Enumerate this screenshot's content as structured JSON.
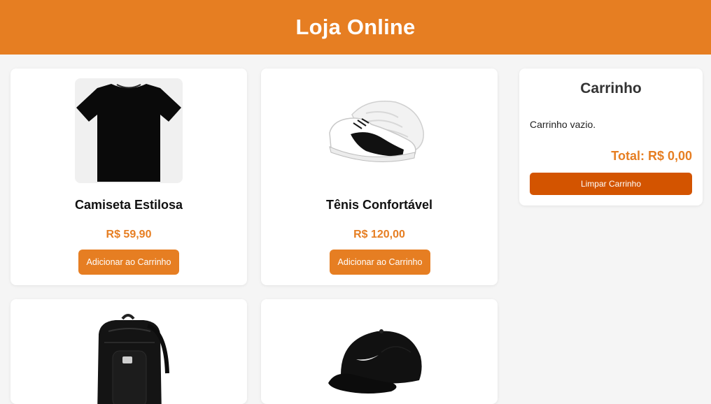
{
  "header": {
    "title": "Loja Online"
  },
  "products": [
    {
      "name": "Camiseta Estilosa",
      "price": "R$ 59,90",
      "button": "Adicionar ao Carrinho",
      "image": "black-tshirt"
    },
    {
      "name": "Tênis Confortável",
      "price": "R$ 120,00",
      "button": "Adicionar ao Carrinho",
      "image": "white-black-sneaker"
    },
    {
      "name": "",
      "price": "",
      "button": "",
      "image": "black-backpack"
    },
    {
      "name": "",
      "price": "",
      "button": "",
      "image": "black-cap"
    }
  ],
  "cart": {
    "title": "Carrinho",
    "empty_text": "Carrinho vazio.",
    "total": "Total: R$ 0,00",
    "clear_button": "Limpar Carrinho"
  },
  "colors": {
    "accent": "#e67e22",
    "clear_button": "#d35400",
    "background": "#f5f5f5"
  }
}
